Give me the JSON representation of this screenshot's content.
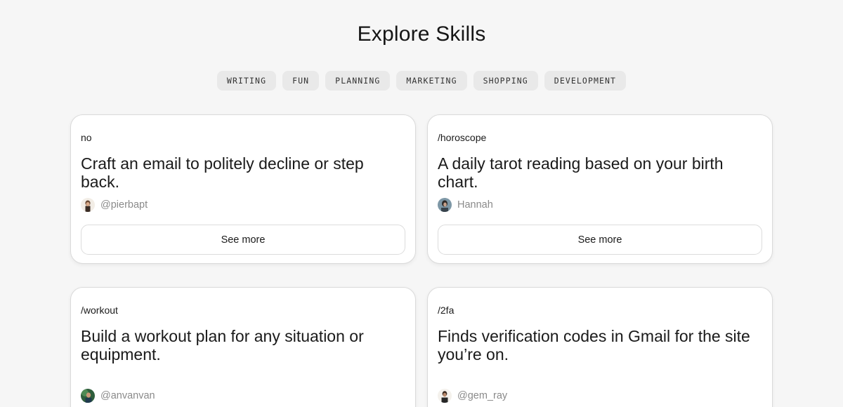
{
  "header": {
    "title": "Explore Skills"
  },
  "categories": [
    "WRITING",
    "FUN",
    "PLANNING",
    "MARKETING",
    "SHOPPING",
    "DEVELOPMENT"
  ],
  "cards": [
    {
      "command": "no",
      "description": "Craft an email to politely decline or step back.",
      "author": "@pierbapt",
      "button": "See more"
    },
    {
      "command": "/horoscope",
      "description": "A daily tarot reading based on your birth chart.",
      "author": "Hannah",
      "button": "See more"
    },
    {
      "command": "/workout",
      "description": "Build a workout plan for any situation or equipment.",
      "author": "@anvanvan"
    },
    {
      "command": "/2fa",
      "description": "Finds verification codes in Gmail for the site you’re on.",
      "author": "@gem_ray"
    }
  ],
  "colors": {
    "background": "#f6f6f6",
    "card": "#ffffff",
    "chip": "#e9e9e9",
    "muted_text": "#8a8a8a"
  }
}
